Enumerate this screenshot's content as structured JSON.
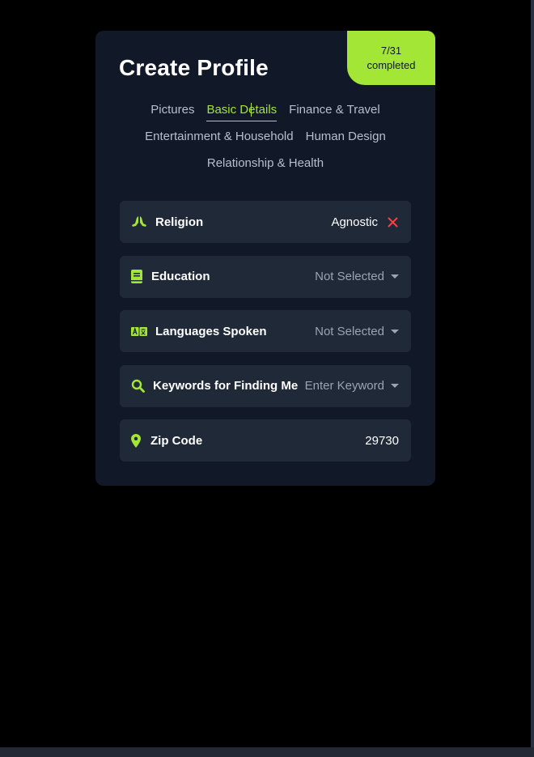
{
  "colors": {
    "accent": "#a3e635",
    "card_bg": "#111827",
    "field_bg": "#1f2937",
    "clear_red": "#ef4444"
  },
  "progress": {
    "count": "7/31",
    "label": "completed",
    "fraction": 0.2258
  },
  "title": "Create Profile",
  "tabs": [
    {
      "label": "Pictures",
      "active": false
    },
    {
      "label": "Basic Details",
      "active": true
    },
    {
      "label": "Finance & Travel",
      "active": false
    },
    {
      "label": "Entertainment & Household",
      "active": false
    },
    {
      "label": "Human Design",
      "active": false
    },
    {
      "label": "Relationship & Health",
      "active": false
    }
  ],
  "fields": [
    {
      "label": "Religion",
      "value": "Agnostic",
      "icon": "praying-hands-icon",
      "action": "clear-icon"
    },
    {
      "label": "Education",
      "value": "Not Selected",
      "icon": "book-icon",
      "action": "caret-down-icon"
    },
    {
      "label": "Languages Spoken",
      "value": "Not Selected",
      "icon": "language-icon",
      "action": "caret-down-icon"
    },
    {
      "label": "Keywords for Finding Me",
      "value": "Enter Keyword",
      "icon": "search-icon",
      "action": "caret-down-icon"
    },
    {
      "label": "Zip Code",
      "value": "29730",
      "icon": "map-pin-icon",
      "action": null
    }
  ]
}
